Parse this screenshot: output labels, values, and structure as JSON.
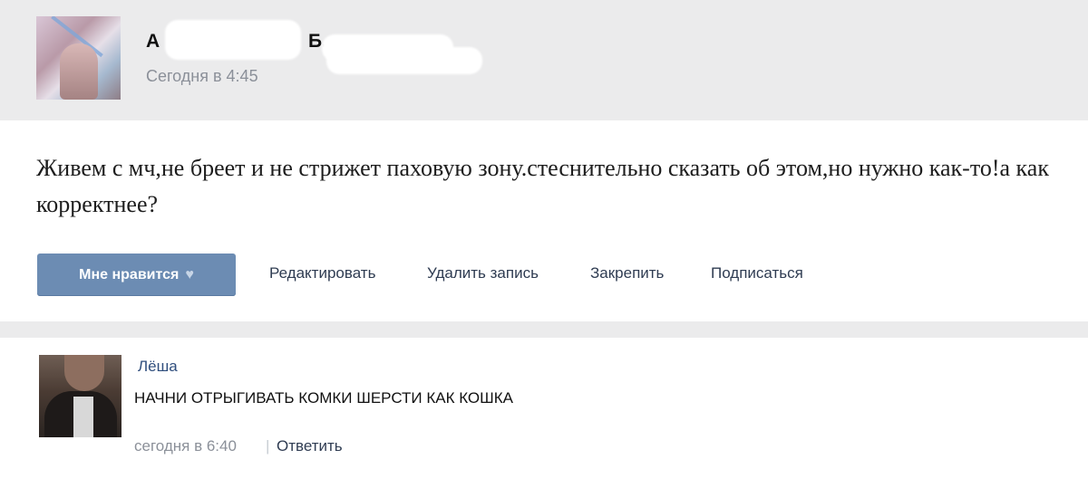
{
  "post": {
    "author_first": "А",
    "author_last": "Б.",
    "time": "Сегодня в 4:45",
    "text": "Живем с мч,не бреет и не стрижет паховую зону.стеснительно сказать об этом,но нужно как-то!а как корректнее?",
    "like_label": "Мне нравится",
    "like_icon": "heart-icon",
    "actions": [
      "Редактировать",
      "Удалить запись",
      "Закрепить",
      "Подписаться"
    ]
  },
  "comment": {
    "author": "Лёша",
    "text": "НАЧНИ ОТРЫГИВАТЬ КОМКИ ШЕРСТИ КАК КОШКА",
    "time": "сегодня в 6:40",
    "separator": "|",
    "reply_label": "Ответить"
  },
  "colors": {
    "accent": "#6c8cb3",
    "header_bg": "#ebebec",
    "link": "#2f4e7d",
    "muted": "#8b9099"
  }
}
